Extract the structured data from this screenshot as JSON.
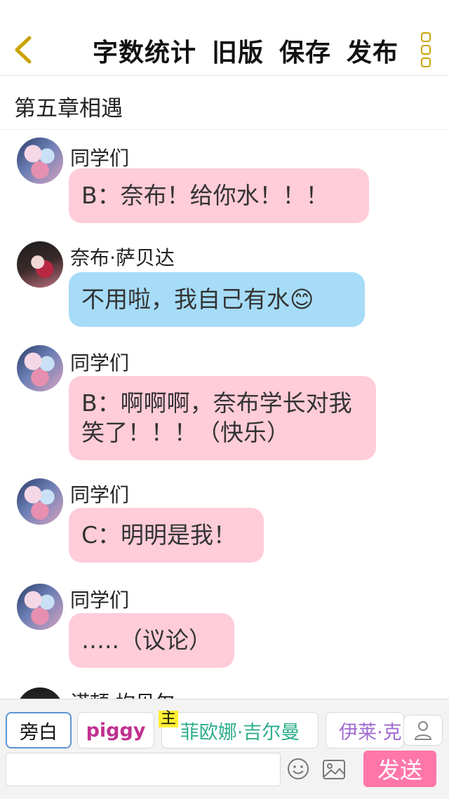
{
  "header": {
    "back_icon": "chevron-left-icon",
    "actions": [
      "字数统计",
      "旧版",
      "保存",
      "发布"
    ],
    "more_icon": "more-vertical-icon",
    "accent_color": "#c9a300"
  },
  "chapter": {
    "title": "第五章相遇"
  },
  "messages": [
    {
      "sender": "同学们",
      "text": "B：奈布！给你水！！！",
      "bubble_color": "#ffccd9"
    },
    {
      "sender": "奈布·萨贝达",
      "text": "不用啦，我自己有水😊",
      "bubble_color": "#a6dcf7"
    },
    {
      "sender": "同学们",
      "text": "B：啊啊啊，奈布学长对我笑了！！！（快乐）",
      "bubble_color": "#ffccd9"
    },
    {
      "sender": "同学们",
      "text": "C：明明是我！",
      "bubble_color": "#ffccd9"
    },
    {
      "sender": "同学们",
      "text": "…..（议论）",
      "bubble_color": "#ffccd9"
    },
    {
      "sender": "诺顿·坎贝尔",
      "text": ""
    }
  ],
  "roles": {
    "narrator": "旁白",
    "piggy": "piggy",
    "main_badge": "主",
    "fio": "菲欧娜·吉尔曼",
    "ilai": "伊莱·克",
    "user_icon": "user-icon"
  },
  "composer": {
    "input_value": "",
    "input_placeholder": "",
    "emoji_icon": "smiley-icon",
    "image_icon": "image-icon",
    "send_label": "发送",
    "send_color": "#ff77a8"
  }
}
